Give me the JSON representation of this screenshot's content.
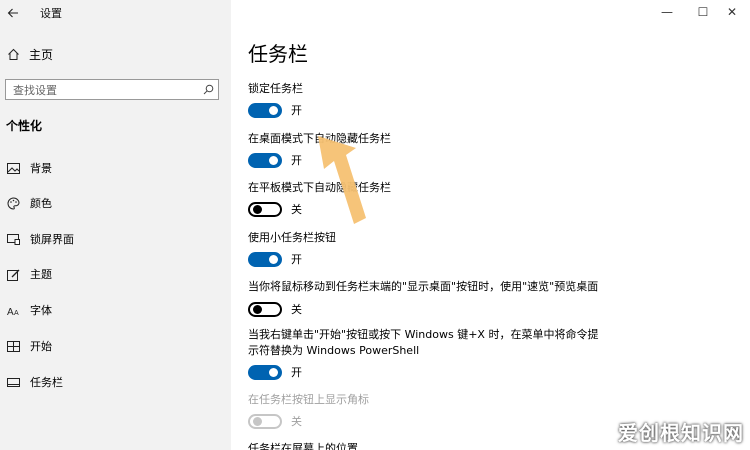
{
  "window": {
    "title": "设置",
    "controls": [
      "—",
      "☐",
      "✕"
    ]
  },
  "sidebar": {
    "home_label": "主页",
    "search_placeholder": "查找设置",
    "section_title": "个性化",
    "items": [
      {
        "label": "背景",
        "icon": "image-icon"
      },
      {
        "label": "颜色",
        "icon": "palette-icon"
      },
      {
        "label": "锁屏界面",
        "icon": "lock-screen-icon"
      },
      {
        "label": "主题",
        "icon": "theme-icon"
      },
      {
        "label": "字体",
        "icon": "font-icon"
      },
      {
        "label": "开始",
        "icon": "start-icon"
      },
      {
        "label": "任务栏",
        "icon": "taskbar-icon"
      }
    ]
  },
  "main": {
    "title": "任务栏",
    "settings": [
      {
        "label": "锁定任务栏",
        "state": "开",
        "on": true
      },
      {
        "label": "在桌面模式下自动隐藏任务栏",
        "state": "开",
        "on": true
      },
      {
        "label": "在平板模式下自动隐藏任务栏",
        "state": "关",
        "on": false
      },
      {
        "label": "使用小任务栏按钮",
        "state": "开",
        "on": true
      },
      {
        "label": "当你将鼠标移动到任务栏末端的\"显示桌面\"按钮时，使用\"速览\"预览桌面",
        "state": "关",
        "on": false
      },
      {
        "label_line1": "当我右键单击\"开始\"按钮或按下 Windows 键+X 时，在菜单中将命令提",
        "label_line2": "示符替换为 Windows PowerShell",
        "state": "开",
        "on": true
      },
      {
        "label": "在任务栏按钮上显示角标",
        "state": "关",
        "on": false,
        "disabled": true
      }
    ],
    "next_heading": "任务栏在屏幕上的位置"
  },
  "watermark": "爱创根知识网",
  "colors": {
    "accent": "#0063b1",
    "sidebar_bg": "#f2f2f2",
    "arrow": "#f5c172"
  }
}
